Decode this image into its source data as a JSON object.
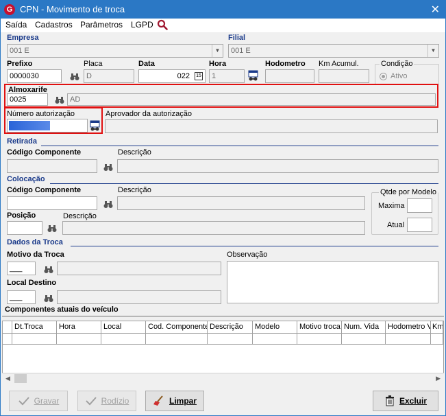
{
  "window": {
    "title": "CPN - Movimento de troca",
    "close_glyph": "✕"
  },
  "menu": {
    "items": [
      "Saída",
      "Cadastros",
      "Parâmetros",
      "LGPD"
    ]
  },
  "empresa": {
    "label": "Empresa",
    "value": "001 E"
  },
  "filial": {
    "label": "Filial",
    "value": "001 E"
  },
  "prefixo": {
    "label": "Prefixo",
    "value": "0000030"
  },
  "placa": {
    "label": "Placa",
    "value": "D"
  },
  "data": {
    "label": "Data",
    "value": "022"
  },
  "hora": {
    "label": "Hora",
    "value": "1"
  },
  "hodometro": {
    "label": "Hodometro"
  },
  "km_acumul": {
    "label": "Km Acumul."
  },
  "condicao": {
    "label": "Condição",
    "option": "Ativo"
  },
  "almoxarife": {
    "label": "Almoxarife",
    "code": "0025",
    "name": "AD"
  },
  "autorizacao": {
    "label": "Número autorização",
    "aprovador_label": "Aprovador da autorização"
  },
  "retirada": {
    "section": "Retirada",
    "codigo_label": "Código Componente",
    "descricao_label": "Descrição"
  },
  "colocacao": {
    "section": "Colocação",
    "codigo_label": "Código Componente",
    "descricao_label": "Descrição",
    "posicao_label": "Posição",
    "posicao_descricao_label": "Descrição",
    "qtde_label": "Qtde por Modelo",
    "maxima_label": "Maxima",
    "atual_label": "Atual"
  },
  "dados_troca": {
    "section": "Dados da Troca",
    "motivo_label": "Motivo da Troca",
    "motivo_value": "___",
    "local_label": "Local Destino",
    "local_value": "___",
    "observacao_label": "Observação"
  },
  "componentes": {
    "title": "Componentes atuais do veículo",
    "columns": [
      "Dt.Troca",
      "Hora",
      "Local",
      "Cod. Componente",
      "Descrição",
      "Modelo",
      "Motivo troca",
      "Num. Vida",
      "Hodometro V",
      "Km"
    ]
  },
  "buttons": {
    "gravar": "Gravar",
    "rodizio": "Rodízio",
    "limpar": "Limpar",
    "excluir": "Excluir"
  }
}
